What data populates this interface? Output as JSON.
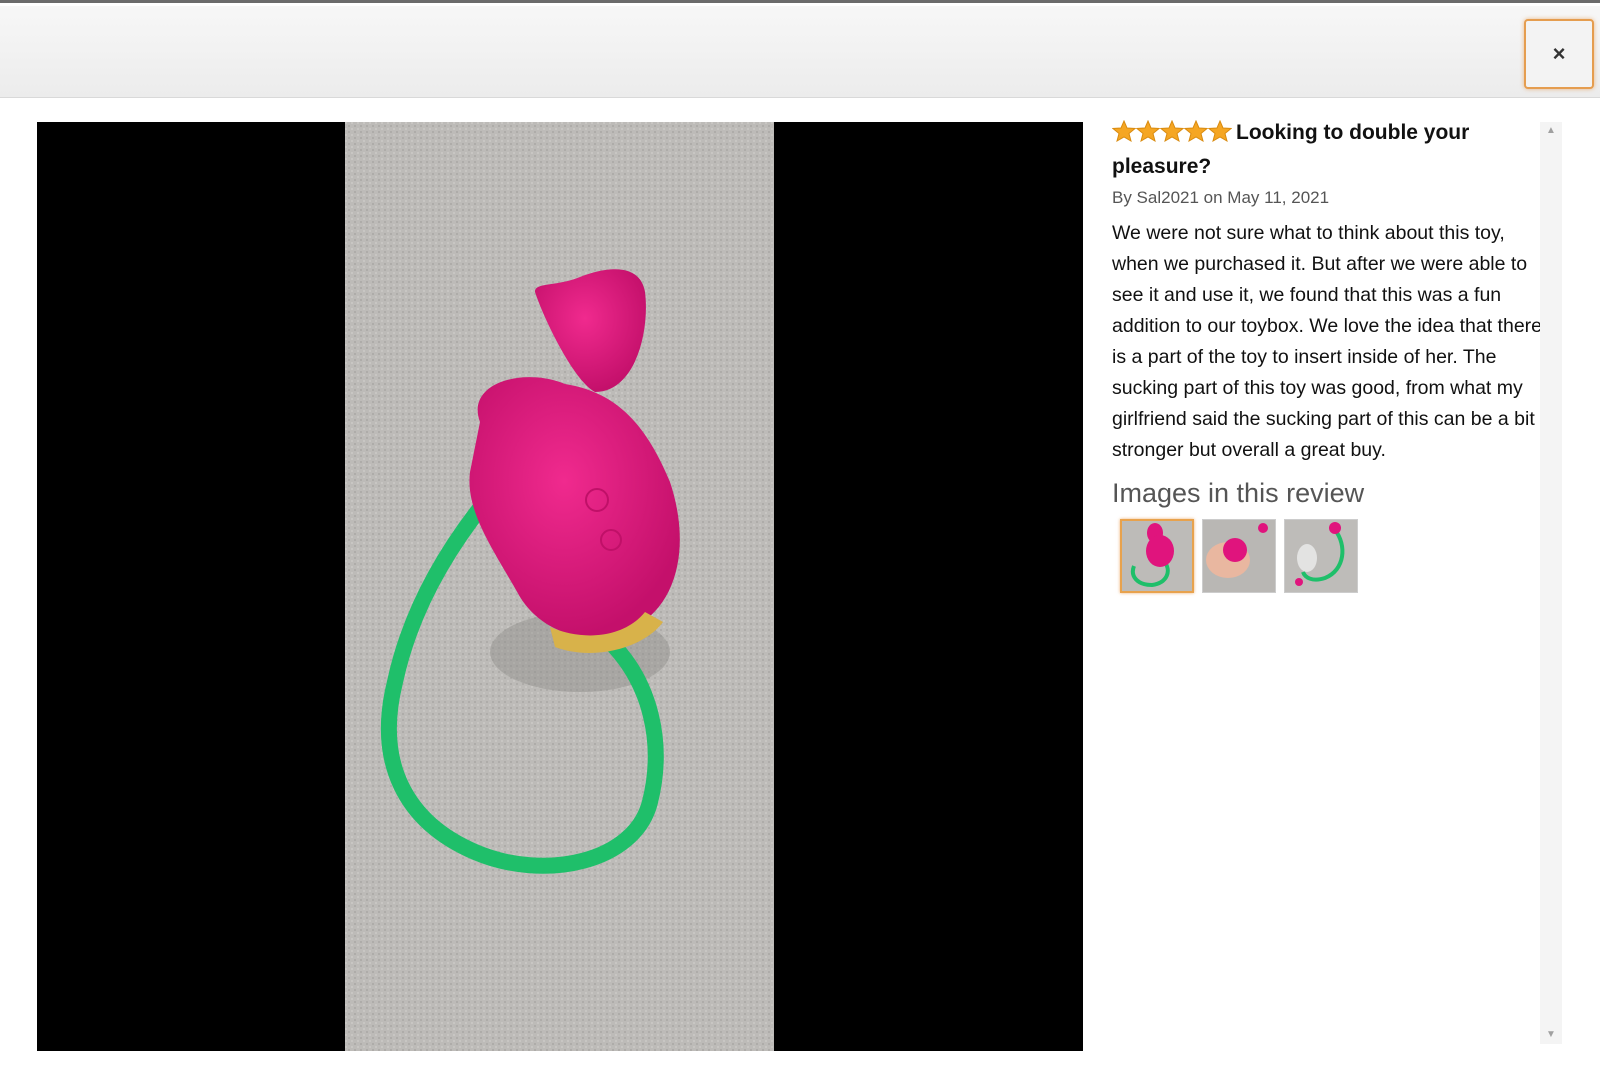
{
  "header": {
    "close_label": "×"
  },
  "review": {
    "rating": 5,
    "rating_max": 5,
    "title": "Looking to double your pleasure?",
    "byline": "By Sal2021 on May 11, 2021",
    "body": "We were not sure what to think about this toy, when we purchased it. But after we were able to see it and use it, we found that this was a fun addition to our toybox. We love the idea that there is a part of the toy to insert inside of her. The sucking part of this toy was good, from what my girlfriend said the sucking part of this can be a bit stronger but overall a great buy."
  },
  "images_section": {
    "heading": "Images in this review",
    "selected_index": 0
  },
  "colors": {
    "star": "#f5a623",
    "accent_border": "#e59d4f",
    "toy_pink": "#e0147d",
    "stem_green": "#22c46e",
    "fabric_gray": "#bcbab7"
  }
}
